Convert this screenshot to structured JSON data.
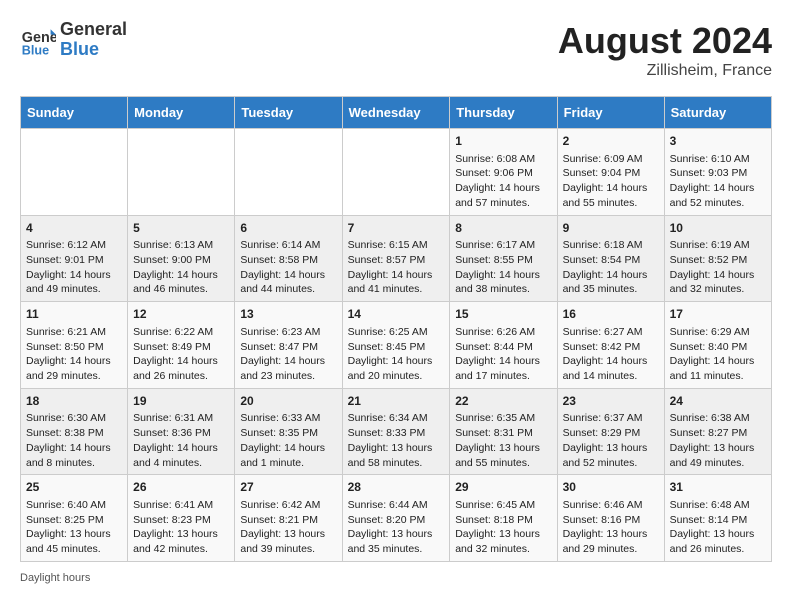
{
  "header": {
    "logo_line1": "General",
    "logo_line2": "Blue",
    "title": "August 2024",
    "subtitle": "Zillisheim, France"
  },
  "days_of_week": [
    "Sunday",
    "Monday",
    "Tuesday",
    "Wednesday",
    "Thursday",
    "Friday",
    "Saturday"
  ],
  "weeks": [
    [
      {
        "day": "",
        "info": ""
      },
      {
        "day": "",
        "info": ""
      },
      {
        "day": "",
        "info": ""
      },
      {
        "day": "",
        "info": ""
      },
      {
        "day": "1",
        "info": "Sunrise: 6:08 AM\nSunset: 9:06 PM\nDaylight: 14 hours and 57 minutes."
      },
      {
        "day": "2",
        "info": "Sunrise: 6:09 AM\nSunset: 9:04 PM\nDaylight: 14 hours and 55 minutes."
      },
      {
        "day": "3",
        "info": "Sunrise: 6:10 AM\nSunset: 9:03 PM\nDaylight: 14 hours and 52 minutes."
      }
    ],
    [
      {
        "day": "4",
        "info": "Sunrise: 6:12 AM\nSunset: 9:01 PM\nDaylight: 14 hours and 49 minutes."
      },
      {
        "day": "5",
        "info": "Sunrise: 6:13 AM\nSunset: 9:00 PM\nDaylight: 14 hours and 46 minutes."
      },
      {
        "day": "6",
        "info": "Sunrise: 6:14 AM\nSunset: 8:58 PM\nDaylight: 14 hours and 44 minutes."
      },
      {
        "day": "7",
        "info": "Sunrise: 6:15 AM\nSunset: 8:57 PM\nDaylight: 14 hours and 41 minutes."
      },
      {
        "day": "8",
        "info": "Sunrise: 6:17 AM\nSunset: 8:55 PM\nDaylight: 14 hours and 38 minutes."
      },
      {
        "day": "9",
        "info": "Sunrise: 6:18 AM\nSunset: 8:54 PM\nDaylight: 14 hours and 35 minutes."
      },
      {
        "day": "10",
        "info": "Sunrise: 6:19 AM\nSunset: 8:52 PM\nDaylight: 14 hours and 32 minutes."
      }
    ],
    [
      {
        "day": "11",
        "info": "Sunrise: 6:21 AM\nSunset: 8:50 PM\nDaylight: 14 hours and 29 minutes."
      },
      {
        "day": "12",
        "info": "Sunrise: 6:22 AM\nSunset: 8:49 PM\nDaylight: 14 hours and 26 minutes."
      },
      {
        "day": "13",
        "info": "Sunrise: 6:23 AM\nSunset: 8:47 PM\nDaylight: 14 hours and 23 minutes."
      },
      {
        "day": "14",
        "info": "Sunrise: 6:25 AM\nSunset: 8:45 PM\nDaylight: 14 hours and 20 minutes."
      },
      {
        "day": "15",
        "info": "Sunrise: 6:26 AM\nSunset: 8:44 PM\nDaylight: 14 hours and 17 minutes."
      },
      {
        "day": "16",
        "info": "Sunrise: 6:27 AM\nSunset: 8:42 PM\nDaylight: 14 hours and 14 minutes."
      },
      {
        "day": "17",
        "info": "Sunrise: 6:29 AM\nSunset: 8:40 PM\nDaylight: 14 hours and 11 minutes."
      }
    ],
    [
      {
        "day": "18",
        "info": "Sunrise: 6:30 AM\nSunset: 8:38 PM\nDaylight: 14 hours and 8 minutes."
      },
      {
        "day": "19",
        "info": "Sunrise: 6:31 AM\nSunset: 8:36 PM\nDaylight: 14 hours and 4 minutes."
      },
      {
        "day": "20",
        "info": "Sunrise: 6:33 AM\nSunset: 8:35 PM\nDaylight: 14 hours and 1 minute."
      },
      {
        "day": "21",
        "info": "Sunrise: 6:34 AM\nSunset: 8:33 PM\nDaylight: 13 hours and 58 minutes."
      },
      {
        "day": "22",
        "info": "Sunrise: 6:35 AM\nSunset: 8:31 PM\nDaylight: 13 hours and 55 minutes."
      },
      {
        "day": "23",
        "info": "Sunrise: 6:37 AM\nSunset: 8:29 PM\nDaylight: 13 hours and 52 minutes."
      },
      {
        "day": "24",
        "info": "Sunrise: 6:38 AM\nSunset: 8:27 PM\nDaylight: 13 hours and 49 minutes."
      }
    ],
    [
      {
        "day": "25",
        "info": "Sunrise: 6:40 AM\nSunset: 8:25 PM\nDaylight: 13 hours and 45 minutes."
      },
      {
        "day": "26",
        "info": "Sunrise: 6:41 AM\nSunset: 8:23 PM\nDaylight: 13 hours and 42 minutes."
      },
      {
        "day": "27",
        "info": "Sunrise: 6:42 AM\nSunset: 8:21 PM\nDaylight: 13 hours and 39 minutes."
      },
      {
        "day": "28",
        "info": "Sunrise: 6:44 AM\nSunset: 8:20 PM\nDaylight: 13 hours and 35 minutes."
      },
      {
        "day": "29",
        "info": "Sunrise: 6:45 AM\nSunset: 8:18 PM\nDaylight: 13 hours and 32 minutes."
      },
      {
        "day": "30",
        "info": "Sunrise: 6:46 AM\nSunset: 8:16 PM\nDaylight: 13 hours and 29 minutes."
      },
      {
        "day": "31",
        "info": "Sunrise: 6:48 AM\nSunset: 8:14 PM\nDaylight: 13 hours and 26 minutes."
      }
    ]
  ],
  "footer": "Daylight hours"
}
